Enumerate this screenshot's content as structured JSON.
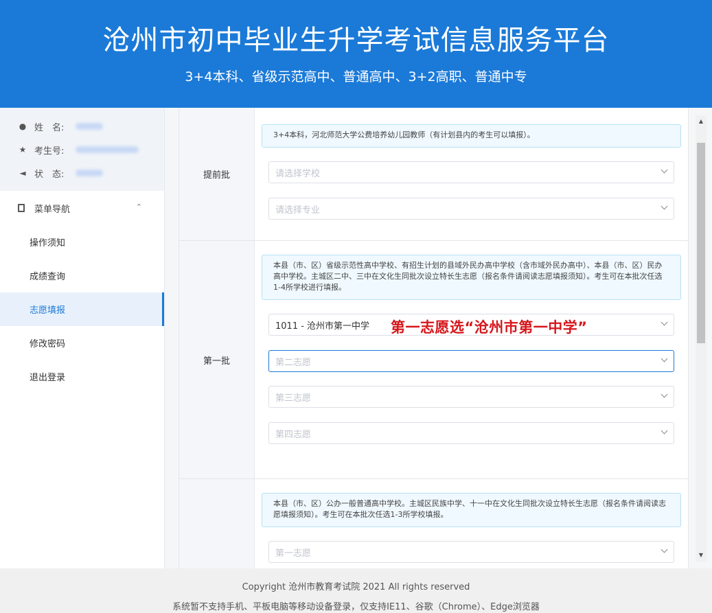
{
  "header": {
    "title": "沧州市初中毕业生升学考试信息服务平台",
    "subtitle": "3+4本科、省级示范高中、普通高中、3+2高职、普通中专"
  },
  "user": {
    "name_label": "姓　名:",
    "id_label": "考生号:",
    "status_label": "状　态:",
    "icons": [
      "user-icon",
      "star-icon",
      "speaker-icon"
    ]
  },
  "nav": {
    "header": "菜单导航",
    "items": [
      {
        "label": "操作须知"
      },
      {
        "label": "成绩查询"
      },
      {
        "label": "志愿填报"
      },
      {
        "label": "修改密码"
      },
      {
        "label": "退出登录"
      }
    ],
    "active": "志愿填报"
  },
  "sections": [
    {
      "label": "提前批",
      "notice": "3+4本科，河北师范大学公费培养幼儿园教师（有计划县内的考生可以填报）。",
      "selects": [
        {
          "placeholder": "请选择学校",
          "value": ""
        },
        {
          "placeholder": "请选择专业",
          "value": ""
        }
      ]
    },
    {
      "label": "第一批",
      "notice": "本县（市、区）省级示范性高中学校、有招生计划的县域外民办高中学校（含市域外民办高中）、本县（市、区）民办高中学校。主城区二中、三中在文化生同批次设立特长生志愿（报名条件请阅读志愿填报须知）。考生可在本批次任选1-4所学校进行填报。",
      "selects": [
        {
          "placeholder": "",
          "value": "1011 - 沧州市第一中学"
        },
        {
          "placeholder": "第二志愿",
          "value": ""
        },
        {
          "placeholder": "第三志愿",
          "value": ""
        },
        {
          "placeholder": "第四志愿",
          "value": ""
        }
      ],
      "annotation": "第一志愿选“沧州市第一中学”"
    },
    {
      "label": "",
      "notice": "本县（市、区）公办一般普通高中学校。主城区民族中学、十一中在文化生同批次设立特长生志愿（报名条件请阅读志愿填报须知）。考生可在本批次任选1-3所学校填报。",
      "selects": [
        {
          "placeholder": "第一志愿",
          "value": ""
        }
      ]
    }
  ],
  "footer": {
    "copyright": "Copyright 沧州市教育考试院 2021 All rights reserved",
    "notice": "系统暂不支持手机、平板电脑等移动设备登录，仅支持IE11、谷歌（Chrome）、Edge浏览器"
  },
  "colors": {
    "header_bg": "#1b7ad8",
    "accent": "#1b7ad8",
    "annotation": "#d6161b"
  }
}
